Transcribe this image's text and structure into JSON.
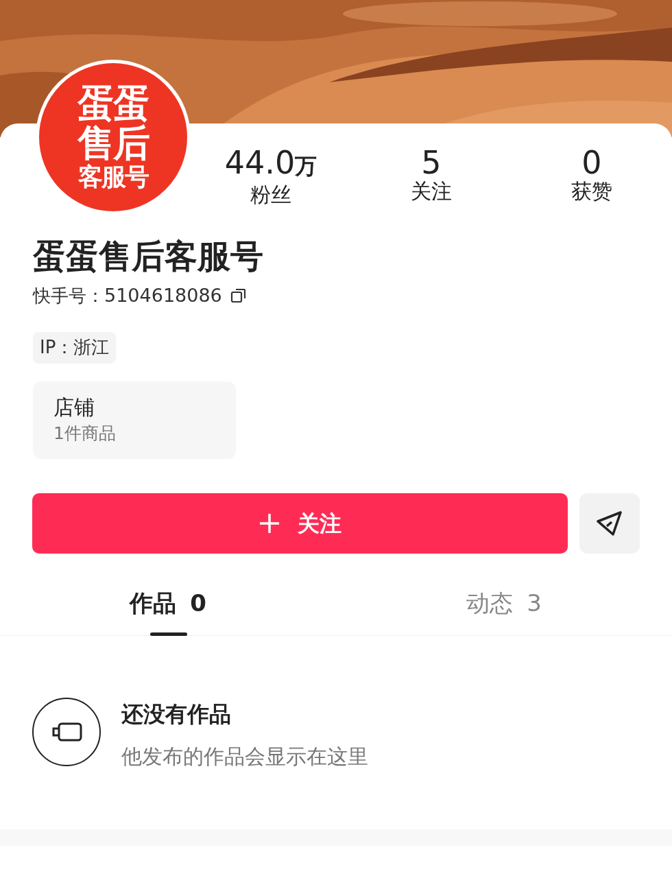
{
  "avatar": {
    "lines": [
      "蛋蛋",
      "售后",
      "客服号"
    ]
  },
  "stats": [
    {
      "value": "44.0",
      "unit": "万",
      "label": "粉丝"
    },
    {
      "value": "5",
      "label": "关注"
    },
    {
      "value": "0",
      "label": "获赞"
    }
  ],
  "profile": {
    "name": "蛋蛋售后客服号",
    "id_label": "快手号：",
    "id_value": "5104618086",
    "ip": "IP：浙江"
  },
  "shop": {
    "title": "店铺",
    "subtitle": "1件商品"
  },
  "follow_button": {
    "label": "关注"
  },
  "tabs": [
    {
      "label": "作品",
      "count": "0",
      "selected": true
    },
    {
      "label": "动态",
      "count": "3",
      "selected": false
    }
  ],
  "empty_state": {
    "title": "还没有作品",
    "message": "他发布的作品会显示在这里"
  }
}
